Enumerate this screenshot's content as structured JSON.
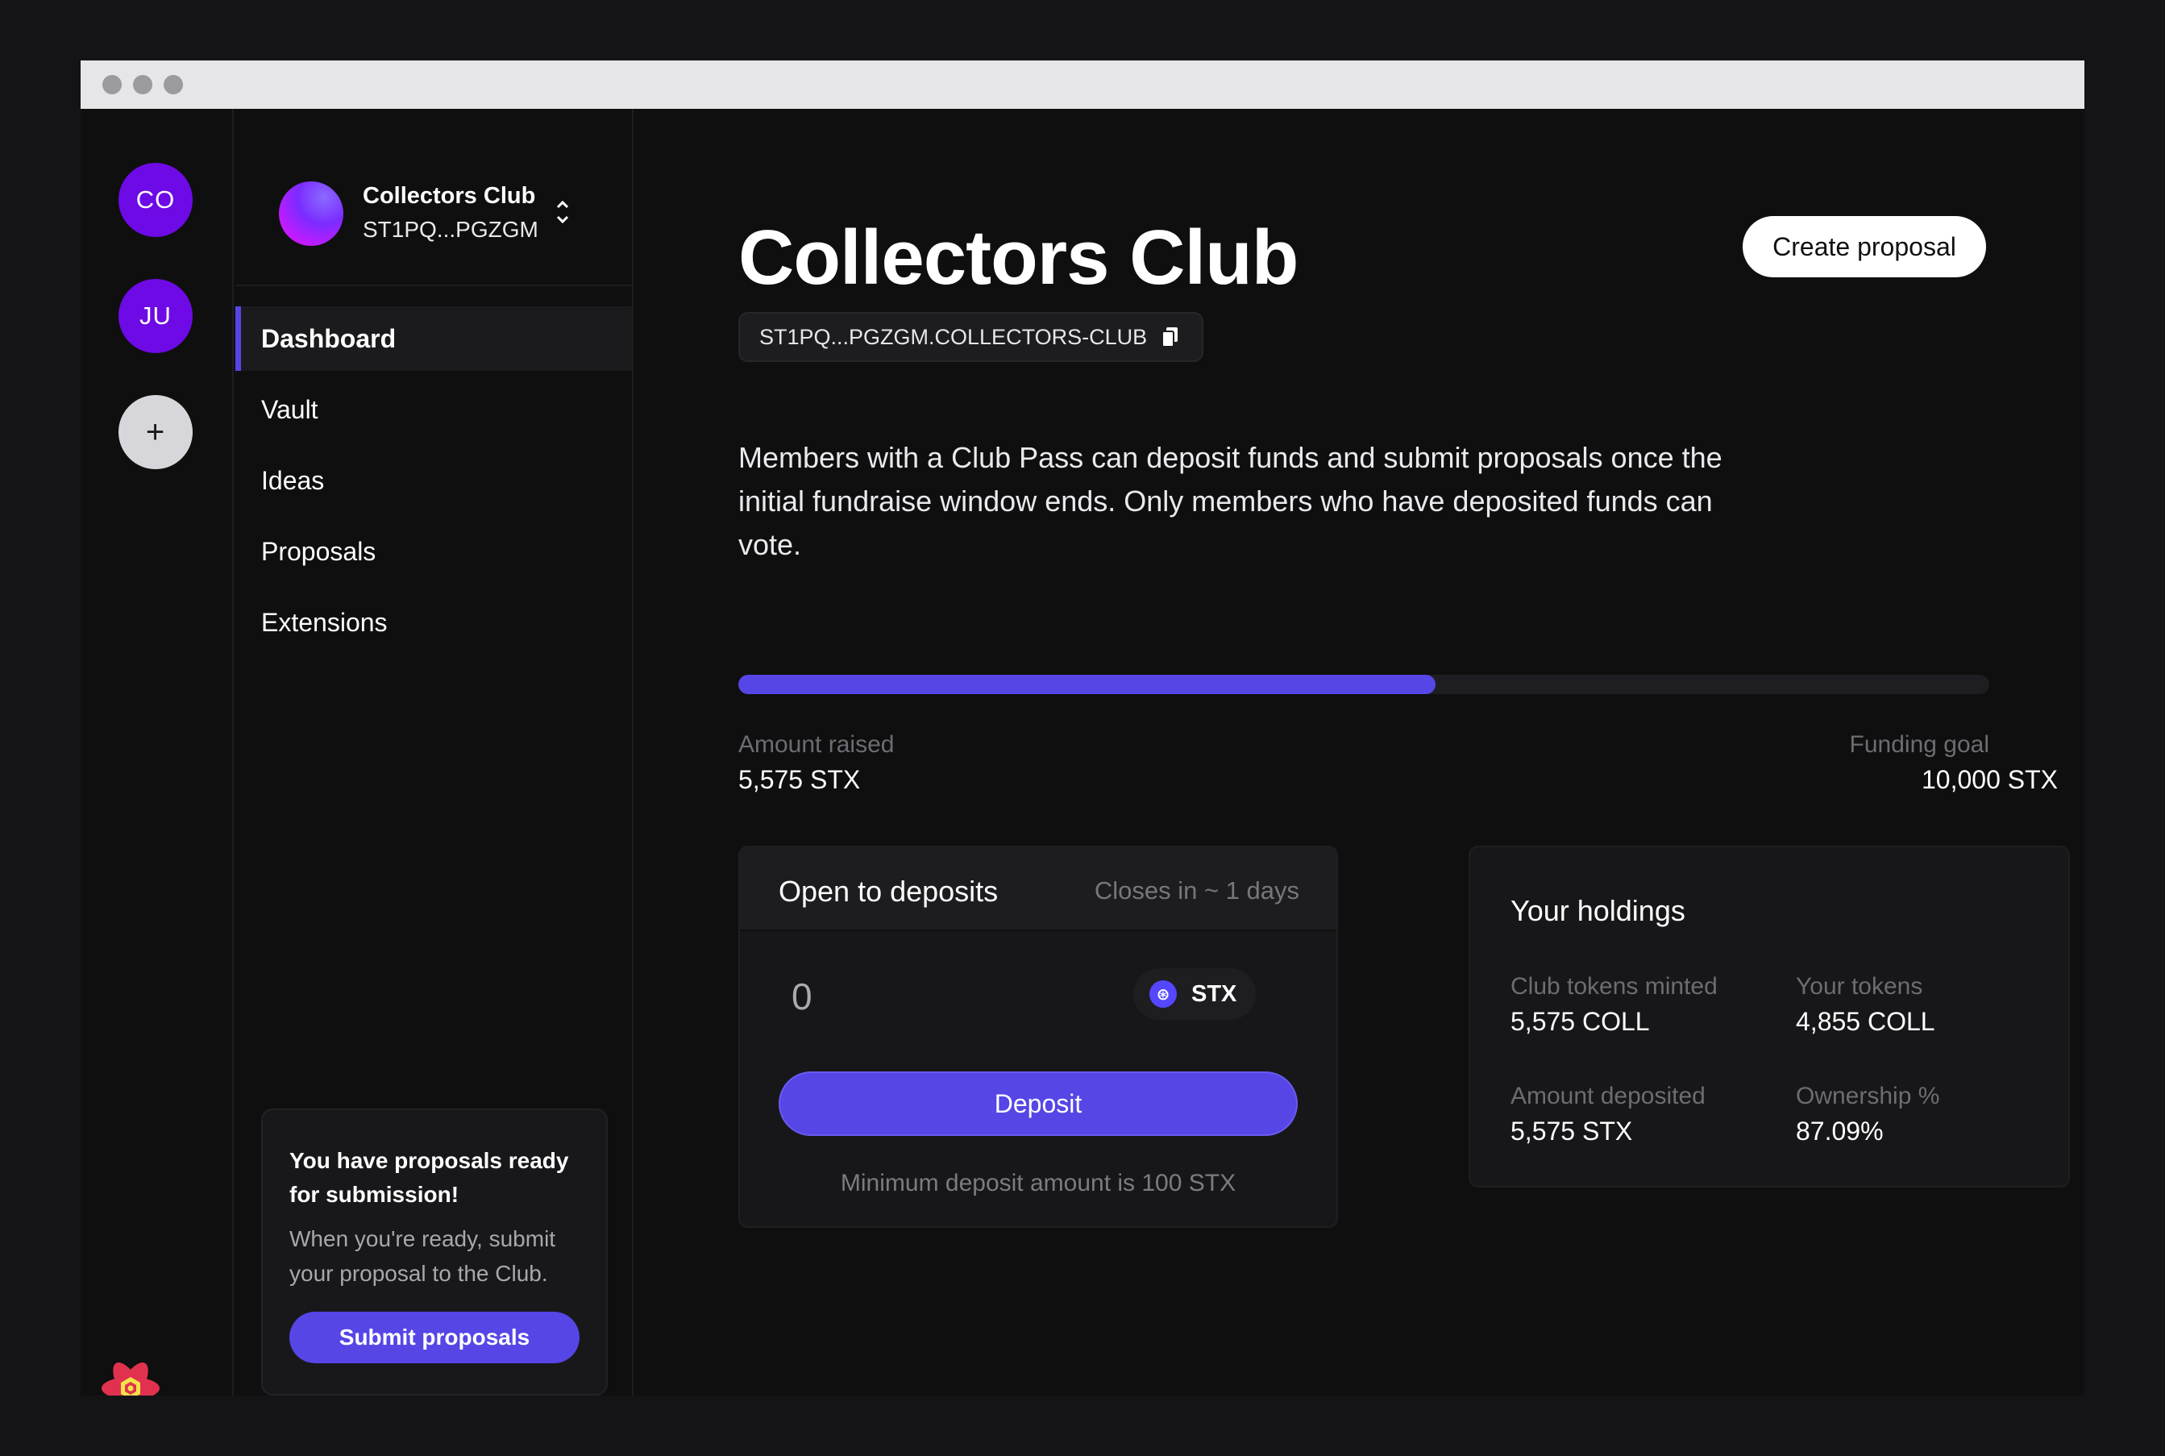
{
  "rail": {
    "clubs": [
      {
        "initials": "CO",
        "color": "#6d0ae6"
      },
      {
        "initials": "JU",
        "color": "#6d0ae6"
      }
    ],
    "add_label": "+"
  },
  "sidebar": {
    "club_name": "Collectors Club",
    "club_address": "ST1PQ...PGZGM",
    "nav": [
      {
        "label": "Dashboard",
        "active": true
      },
      {
        "label": "Vault",
        "active": false
      },
      {
        "label": "Ideas",
        "active": false
      },
      {
        "label": "Proposals",
        "active": false
      },
      {
        "label": "Extensions",
        "active": false
      }
    ],
    "promo": {
      "title": "You have proposals ready for submission!",
      "body": "When you're ready, submit your proposal to the Club.",
      "button": "Submit proposals"
    }
  },
  "main": {
    "title": "Collectors Club",
    "create_button": "Create proposal",
    "contract": "ST1PQ...PGZGM.COLLECTORS-CLUB",
    "description": "Members with a Club Pass can deposit funds and submit proposals once the initial fundraise window ends. Only members who have deposited funds can vote.",
    "fundraise": {
      "progress_fraction": 0.5575,
      "amount_raised_label": "Amount raised",
      "amount_raised": "5,575 STX",
      "goal_label": "Funding goal",
      "goal": "10,000 STX"
    },
    "deposit": {
      "title": "Open to deposits",
      "closes": "Closes in ~ 1 days",
      "amount": "0",
      "token": "STX",
      "button": "Deposit",
      "min_note": "Minimum deposit amount is 100 STX"
    },
    "holdings": {
      "title": "Your holdings",
      "items": [
        {
          "label": "Club tokens minted",
          "value": "5,575 COLL"
        },
        {
          "label": "Your tokens",
          "value": "4,855 COLL"
        },
        {
          "label": "Amount deposited",
          "value": "5,575 STX"
        },
        {
          "label": "Ownership %",
          "value": "87.09%"
        }
      ]
    }
  },
  "colors": {
    "accent": "#5646e6",
    "club_avatar": "#6d0ae6",
    "background": "#0f0f10"
  },
  "icons": {
    "switcher": "chevron-up-down-icon",
    "copy": "copy-icon",
    "token": "stx-icon",
    "logo": "app-logo-icon"
  }
}
